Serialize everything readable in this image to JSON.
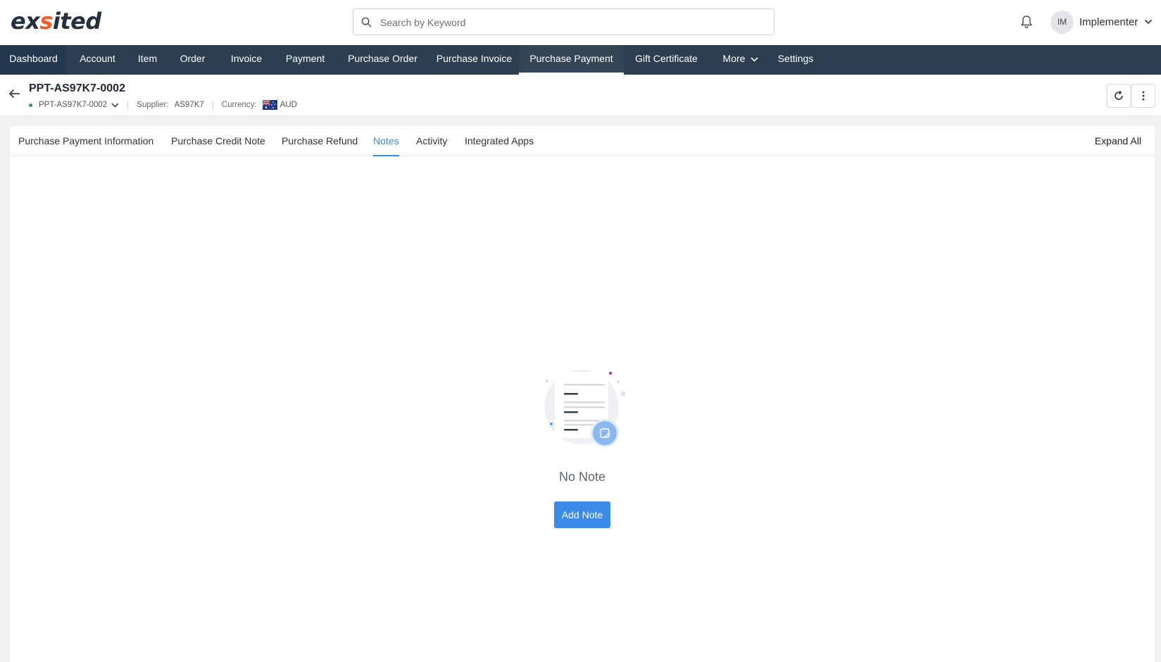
{
  "brand": {
    "logo_text_a": "ex",
    "logo_text_b": "s",
    "logo_text_c": "ited",
    "accent": "#f15a29",
    "dark": "#253041"
  },
  "search": {
    "placeholder": "Search by Keyword",
    "value": ""
  },
  "user": {
    "initials": "IM",
    "name": "Implementer"
  },
  "nav": {
    "items": [
      {
        "label": "Dashboard"
      },
      {
        "label": "Account"
      },
      {
        "label": "Item"
      },
      {
        "label": "Order"
      },
      {
        "label": "Invoice"
      },
      {
        "label": "Payment"
      },
      {
        "label": "Purchase Order"
      },
      {
        "label": "Purchase Invoice"
      },
      {
        "label": "Purchase Payment",
        "active": true
      },
      {
        "label": "Gift Certificate"
      },
      {
        "label": "More"
      },
      {
        "label": "Settings"
      }
    ],
    "bg_color": "#2d3e50"
  },
  "record": {
    "title": "PPT-AS97K7-0002",
    "id_select": "PPT-AS97K7-0002",
    "supplier_label": "Supplier:",
    "supplier_value": "AS97K7",
    "currency_label": "Currency:",
    "currency_value": "AUD",
    "status_color": "#2ea043"
  },
  "tabs": {
    "items": [
      {
        "label": "Purchase Payment Information"
      },
      {
        "label": "Purchase Credit Note"
      },
      {
        "label": "Purchase Refund"
      },
      {
        "label": "Notes",
        "active": true
      },
      {
        "label": "Activity"
      },
      {
        "label": "Integrated Apps"
      }
    ],
    "expand_all": "Expand All",
    "active_color": "#3b8ae6"
  },
  "empty_state": {
    "message": "No Note",
    "button_label": "Add Note",
    "icon": "note-document-icon"
  }
}
